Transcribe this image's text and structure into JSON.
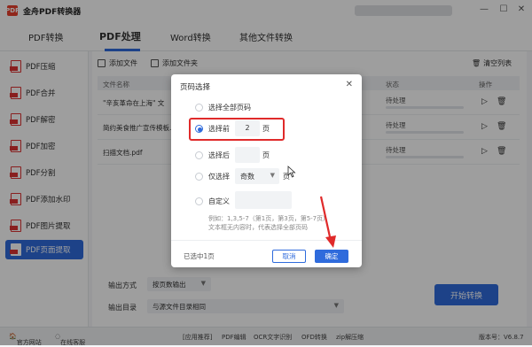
{
  "app": {
    "title": "金舟PDF转换器",
    "logo": "PDF"
  },
  "window": {
    "min": "—",
    "max": "☐",
    "close": "✕"
  },
  "topnav": [
    "PDF转换",
    "PDF处理",
    "Word转换",
    "其他文件转换"
  ],
  "sidebar": [
    {
      "label": "PDF压缩"
    },
    {
      "label": "PDF合并"
    },
    {
      "label": "PDF解密"
    },
    {
      "label": "PDF加密"
    },
    {
      "label": "PDF分割"
    },
    {
      "label": "PDF添加水印"
    },
    {
      "label": "PDF图片提取"
    },
    {
      "label": "PDF页面提取"
    }
  ],
  "toolbar": {
    "add_file": "添加文件",
    "add_folder": "添加文件夹",
    "clear": "清空列表"
  },
  "table": {
    "headers": {
      "name": "文件名称",
      "status": "状态",
      "action": "操作"
    },
    "rows": [
      {
        "name": "\"辛亥革命在上海\" 文",
        "status": "待处理"
      },
      {
        "name": "简约美食推广宣传模板.",
        "status": "待处理"
      },
      {
        "name": "扫描文档.pdf",
        "status": "待处理"
      }
    ]
  },
  "output": {
    "mode_label": "输出方式",
    "mode_value": "按页数输出",
    "dir_label": "输出目录",
    "dir_value": "与源文件目录相同",
    "start": "开始转换"
  },
  "statusbar": {
    "website": "官方网站",
    "service": "在线客服",
    "links": [
      "[应用推荐]",
      "PDF编辑",
      "OCR文字识别",
      "OFD转换",
      "zip解压缩"
    ],
    "version": "版本号：V6.8.7"
  },
  "dialog": {
    "title": "页码选择",
    "opt_all": "选择全部页码",
    "opt_first": "选择前",
    "first_value": "2",
    "page_unit": "页",
    "opt_last": "选择后",
    "last_value": "",
    "opt_only": "仅选择",
    "only_value": "奇数",
    "opt_custom": "自定义",
    "custom_value": "",
    "hint1": "例如：1,3,5-7（第1页，第3页，第5-7页）",
    "hint2": "文本框无内容时，代表选择全部页码",
    "selected": "已选中1页",
    "cancel": "取消",
    "ok": "确定"
  },
  "colors": {
    "accent": "#2f6bdc",
    "highlight": "#e02a2a",
    "pdf_red": "#dd3333"
  }
}
